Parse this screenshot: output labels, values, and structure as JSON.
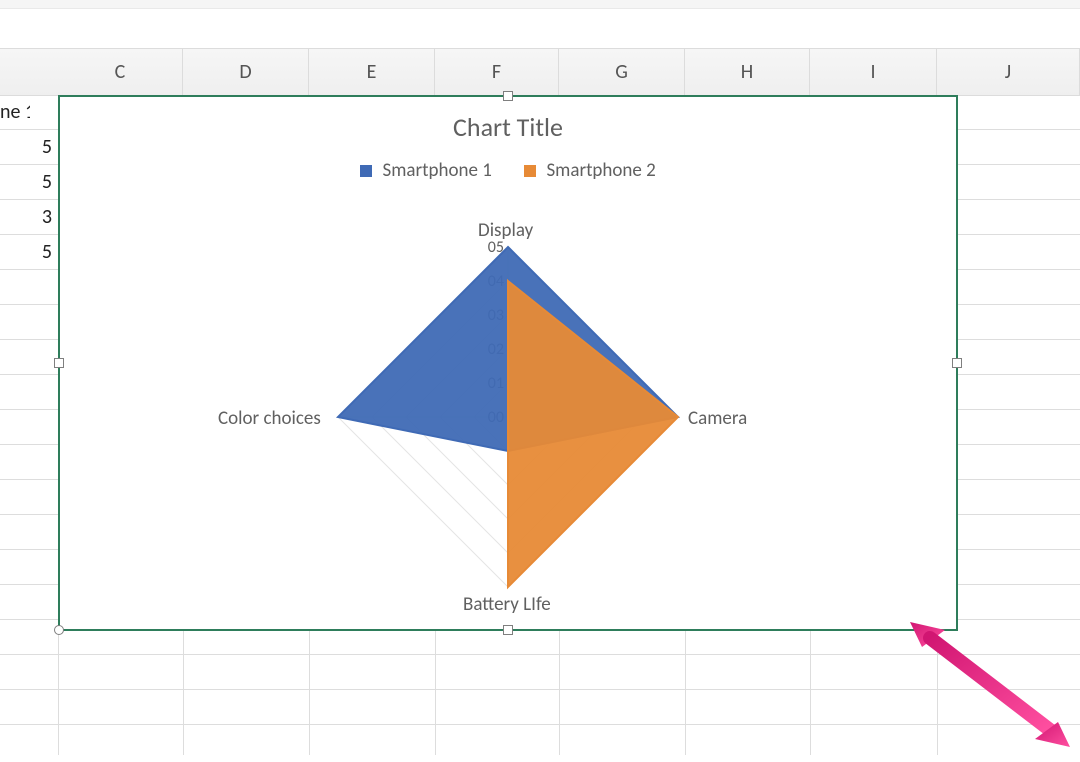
{
  "columns": [
    "C",
    "D",
    "E",
    "F",
    "G",
    "H",
    "I",
    "J"
  ],
  "col_starts": [
    58,
    183,
    309,
    435,
    559,
    685,
    810,
    937,
    1080
  ],
  "row_label_fragment": "ne 1",
  "left_cells": [
    "5",
    "5",
    "3",
    "5"
  ],
  "chart_title": "Chart Title",
  "legend": [
    {
      "name": "Smartphone 1",
      "color": "#3f6ab5"
    },
    {
      "name": "Smartphone 2",
      "color": "#e78a36"
    }
  ],
  "axis_ticks": [
    "0",
    "1",
    "2",
    "3",
    "4",
    "5"
  ],
  "categories": [
    "Display",
    "Camera",
    "Battery LIfe",
    "Color choices"
  ],
  "chart_data": {
    "type": "radar",
    "title": "Chart Title",
    "categories": [
      "Display",
      "Camera",
      "Battery LIfe",
      "Color choices"
    ],
    "axis": {
      "min": 0,
      "max": 5,
      "step": 1
    },
    "series": [
      {
        "name": "Smartphone 1",
        "color": "#3f6ab5",
        "values": [
          5,
          5,
          1,
          5
        ]
      },
      {
        "name": "Smartphone 2",
        "color": "#e78a36",
        "values": [
          4,
          5,
          5,
          0
        ]
      }
    ],
    "legend_position": "top"
  },
  "cursor_color": "#e6318a"
}
